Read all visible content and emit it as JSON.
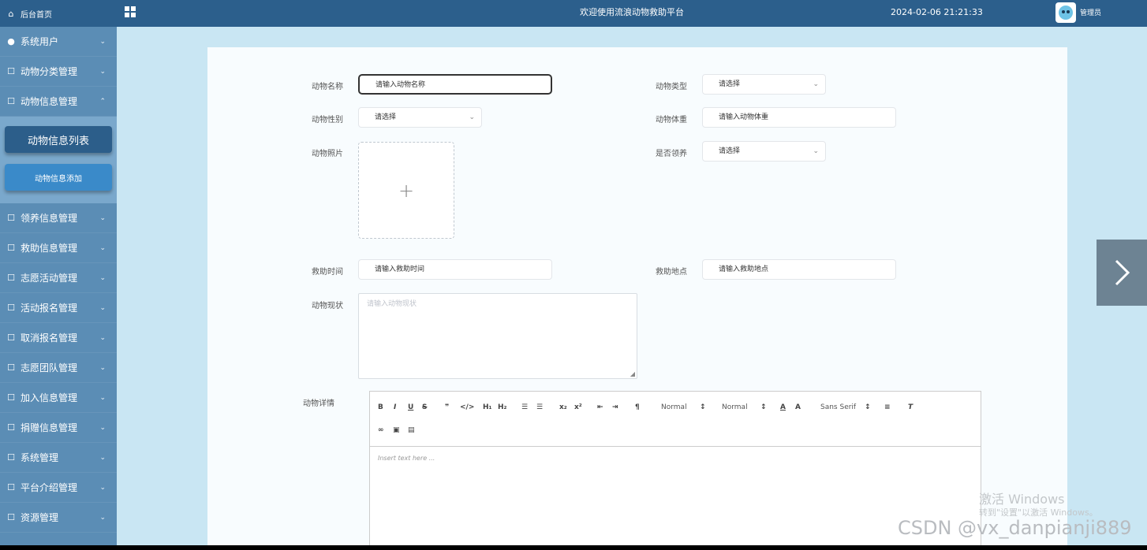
{
  "sidebar": {
    "home": "后台首页",
    "items_top": [
      {
        "label": "系统用户",
        "icon": "user-icon"
      },
      {
        "label": "动物分类管理",
        "icon": "external-icon"
      },
      {
        "label": "动物信息管理",
        "icon": "external-icon",
        "expanded": true
      }
    ],
    "sub": {
      "list": "动物信息列表",
      "add": "动物信息添加"
    },
    "items_bottom": [
      {
        "label": "领养信息管理"
      },
      {
        "label": "救助信息管理"
      },
      {
        "label": "志愿活动管理"
      },
      {
        "label": "活动报名管理"
      },
      {
        "label": "取消报名管理"
      },
      {
        "label": "志愿团队管理"
      },
      {
        "label": "加入信息管理"
      },
      {
        "label": "捐赠信息管理"
      },
      {
        "label": "系统管理"
      },
      {
        "label": "平台介绍管理"
      },
      {
        "label": "资源管理"
      }
    ]
  },
  "header": {
    "title": "欢迎使用流浪动物救助平台",
    "time": "2024-02-06 21:21:33",
    "user": "管理员"
  },
  "form": {
    "name_label": "动物名称",
    "name_placeholder": "请输入动物名称",
    "type_label": "动物类型",
    "type_value": "请选择",
    "gender_label": "动物性别",
    "gender_value": "请选择",
    "weight_label": "动物体重",
    "weight_placeholder": "请输入动物体重",
    "photo_label": "动物照片",
    "adopted_label": "是否领养",
    "adopted_value": "请选择",
    "rescue_time_label": "救助时间",
    "rescue_time_placeholder": "请输入救助时间",
    "rescue_place_label": "救助地点",
    "rescue_place_placeholder": "请输入救助地点",
    "status_label": "动物现状",
    "status_placeholder": "请输入动物现状",
    "detail_label": "动物详情"
  },
  "editor": {
    "font_size_1": "Normal",
    "font_size_2": "Normal",
    "font_family": "Sans Serif",
    "placeholder": "Insert text here ..."
  },
  "watermarks": {
    "win1": "激活 Windows",
    "win2": "转到\"设置\"以激活 Windows。",
    "csdn": "CSDN @vx_danpianji889"
  },
  "colors": {
    "header": "#2c5f8c",
    "sidebar": "#5b8db5",
    "content_bg": "#c9e6f3"
  }
}
